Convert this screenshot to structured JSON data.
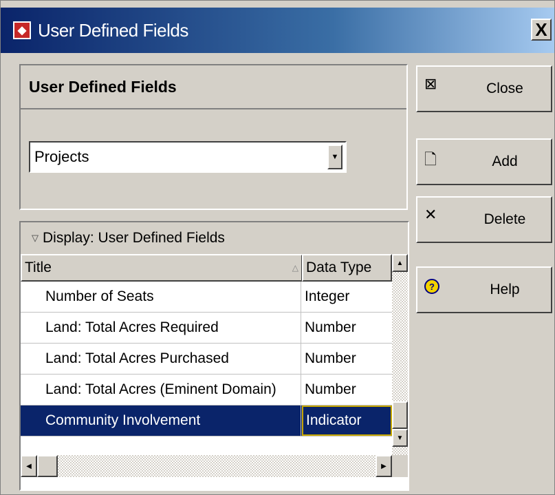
{
  "window": {
    "title": "User Defined Fields",
    "close_glyph": "X",
    "app_icon": "app-logo-icon",
    "accent": "#0a246a"
  },
  "panel": {
    "heading": "User Defined Fields",
    "select_value": "Projects"
  },
  "grid": {
    "caption": "Display: User Defined Fields",
    "columns": [
      "Title",
      "Data Type"
    ],
    "rows": [
      {
        "title": "Number of Seats",
        "type": "Integer"
      },
      {
        "title": "Land: Total Acres Required",
        "type": "Number"
      },
      {
        "title": "Land: Total Acres Purchased",
        "type": "Number"
      },
      {
        "title": "Land: Total Acres (Eminent Domain)",
        "type": "Number"
      },
      {
        "title": "Community Involvement",
        "type": "Indicator",
        "selected": true
      }
    ],
    "selected_color": "#0a246a"
  },
  "buttons": {
    "close": "Close",
    "add": "Add",
    "delete": "Delete",
    "help": "Help"
  }
}
